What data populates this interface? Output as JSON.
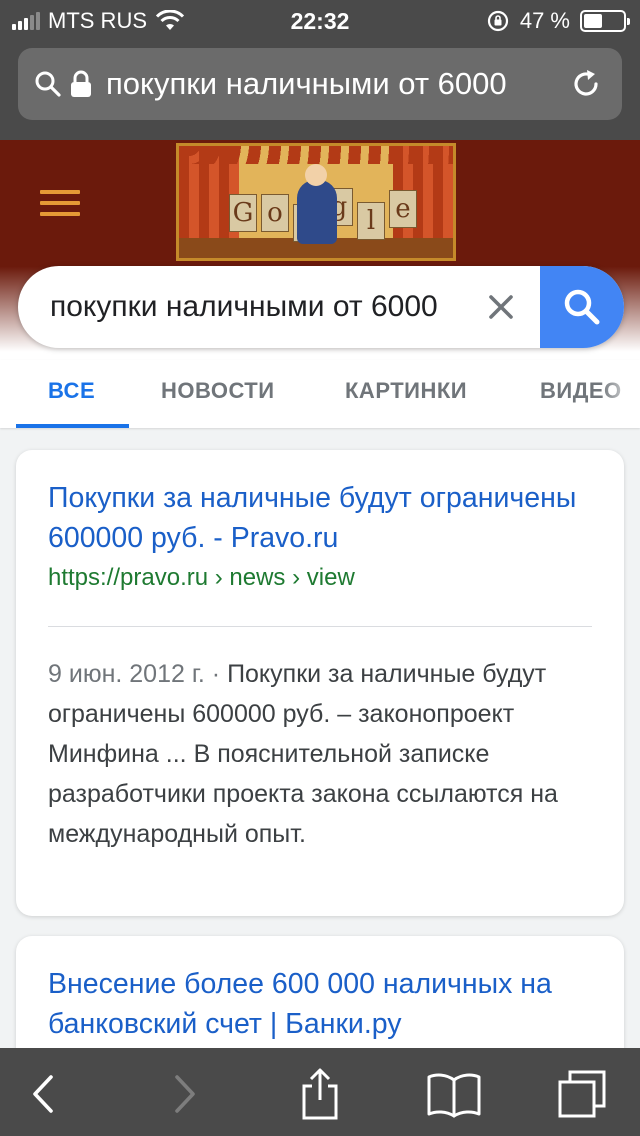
{
  "status_bar": {
    "carrier": "MTS RUS",
    "time": "22:32",
    "battery_percent": "47 %",
    "battery_level": 0.47,
    "signal_bars": 3,
    "signal_total": 5
  },
  "address_bar": {
    "url_text": "покупки наличными от 6000",
    "icons": [
      "search-icon",
      "lock-icon",
      "reload-icon"
    ]
  },
  "header": {
    "doodle_letters": [
      "G",
      "o",
      "o",
      "g",
      "l",
      "e"
    ],
    "menu_icon": "hamburger-icon",
    "colors": {
      "header_bg": "#6b1a0c",
      "menu_accent": "#e69a36"
    }
  },
  "search": {
    "query": "покупки наличными от 6000",
    "clear_icon": "close-icon",
    "submit_icon": "search-icon",
    "button_color": "#4285f4"
  },
  "tabs": [
    {
      "label": "ВСЕ",
      "active": true
    },
    {
      "label": "НОВОСТИ",
      "active": false
    },
    {
      "label": "КАРТИНКИ",
      "active": false
    },
    {
      "label": "ВИДЕО",
      "active": false
    }
  ],
  "results": [
    {
      "title": "Покупки за наличные будут ограничены 600000 руб. - Pravo.ru",
      "url": "https://pravo.ru › news › view",
      "date": "9 июн. 2012 г. · ",
      "snippet": "Покупки за наличные будут ограничены 600000 руб. – законопроект Минфина ... В пояснительной записке разработчики проекта закона ссылаются на международный опыт."
    },
    {
      "title": "Внесение более 600 000 наличных на банковский счет | Банки.ру"
    }
  ],
  "toolbar": {
    "buttons": [
      "back-icon",
      "forward-icon",
      "share-icon",
      "bookmarks-icon",
      "tabs-icon"
    ]
  }
}
